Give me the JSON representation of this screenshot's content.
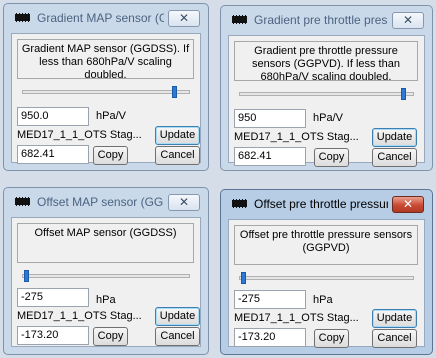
{
  "colors": {
    "accent": "#2a7bd8",
    "close_active": "#c94a33"
  },
  "dialogs": [
    {
      "title": "Gradient MAP sensor (GGDSS)",
      "description": "Gradient MAP sensor (GGDSS). If less than 680hPa/V scaling doubled.",
      "slider_fraction": 0.92,
      "value": "950.0",
      "unit": "hPa/V",
      "source": "MED17_1_1_OTS Stag...",
      "computed": "682.41",
      "update_label": "Update",
      "copy_label": "Copy",
      "cancel_label": "Cancel",
      "close_glyph": "✕",
      "active": false
    },
    {
      "title": "Gradient pre throttle pressure sensors (GGPVD)",
      "description": "Gradient pre throttle pressure sensors (GGPVD). If less than 680hPa/V scaling doubled.",
      "slider_fraction": 0.95,
      "value": "950",
      "unit": "hPa/V",
      "source": "MED17_1_1_OTS Stag...",
      "computed": "682.41",
      "update_label": "Update",
      "copy_label": "Copy",
      "cancel_label": "Cancel",
      "close_glyph": "✕",
      "active": false
    },
    {
      "title": "Offset MAP sensor (GGDSS)",
      "description": "Offset MAP sensor (GGDSS)",
      "slider_fraction": 0.01,
      "value": "-275",
      "unit": "hPa",
      "source": "MED17_1_1_OTS Stag...",
      "computed": "-173.20",
      "update_label": "Update",
      "copy_label": "Copy",
      "cancel_label": "Cancel",
      "close_glyph": "✕",
      "active": false
    },
    {
      "title": "Offset pre throttle pressure sensors (GGPVD)",
      "description": "Offset pre throttle pressure sensors (GGPVD)",
      "slider_fraction": 0.01,
      "value": "-275",
      "unit": "hPa",
      "source": "MED17_1_1_OTS Stag...",
      "computed": "-173.20",
      "update_label": "Update",
      "copy_label": "Copy",
      "cancel_label": "Cancel",
      "close_glyph": "✕",
      "active": true
    }
  ]
}
